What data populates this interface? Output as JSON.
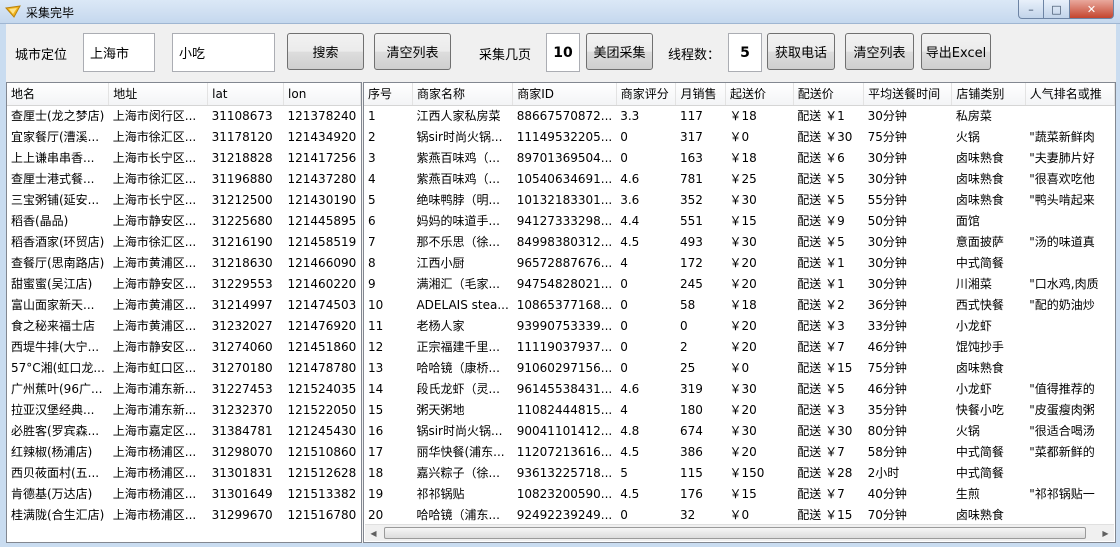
{
  "window": {
    "title": "采集完毕",
    "min": "–",
    "max": "□",
    "close": "✕"
  },
  "toolbar": {
    "city_label": "城市定位",
    "city_value": "上海市",
    "keyword_value": "小吃",
    "search_btn": "搜索",
    "clear_btn1": "清空列表",
    "pages_label": "采集几页",
    "pages_value": "10",
    "meituan_btn": "美团采集",
    "threads_label": "线程数：",
    "threads_value": "5",
    "phone_btn": "获取电话",
    "clear_btn2": "清空列表",
    "export_btn": "导出Excel"
  },
  "left_grid": {
    "columns": [
      "地名",
      "地址",
      "lat",
      "lon"
    ],
    "rows": [
      [
        "查厘士(龙之梦店)",
        "上海市闵行区...",
        "31108673",
        "121378240"
      ],
      [
        "宜家餐厅(漕溪...",
        "上海市徐汇区...",
        "31178120",
        "121434920"
      ],
      [
        "上上谦串串香...",
        "上海市长宁区...",
        "31218828",
        "121417256"
      ],
      [
        "查厘士港式餐...",
        "上海市徐汇区...",
        "31196880",
        "121437280"
      ],
      [
        "三宝粥铺(延安...",
        "上海市长宁区...",
        "31212500",
        "121430190"
      ],
      [
        "稻香(晶品)",
        "上海市静安区...",
        "31225680",
        "121445895"
      ],
      [
        "稻香酒家(环贸店)",
        "上海市徐汇区...",
        "31216190",
        "121458519"
      ],
      [
        "查餐厅(思南路店)",
        "上海市黄浦区...",
        "31218630",
        "121466090"
      ],
      [
        "甜蜜蜜(吴江店)",
        "上海市静安区...",
        "31229553",
        "121460220"
      ],
      [
        "富山面家新天...",
        "上海市黄浦区...",
        "31214997",
        "121474503"
      ],
      [
        "食之秘来福士店",
        "上海市黄浦区...",
        "31232027",
        "121476920"
      ],
      [
        "西堤牛排(大宁...",
        "上海市静安区...",
        "31274060",
        "121451860"
      ],
      [
        "57°C湘(虹口龙...",
        "上海市虹口区...",
        "31270180",
        "121478780"
      ],
      [
        "广州蕉叶(96广...",
        "上海市浦东新...",
        "31227453",
        "121524035"
      ],
      [
        "拉亚汉堡经典...",
        "上海市浦东新...",
        "31232370",
        "121522050"
      ],
      [
        "必胜客(罗宾森...",
        "上海市嘉定区...",
        "31384781",
        "121245430"
      ],
      [
        "红辣椒(杨浦店)",
        "上海市杨浦区...",
        "31298070",
        "121510860"
      ],
      [
        "西贝莜面村(五...",
        "上海市杨浦区...",
        "31301831",
        "121512628"
      ],
      [
        "肯德基(万达店)",
        "上海市杨浦区...",
        "31301649",
        "121513382"
      ],
      [
        "桂满陇(合生汇店)",
        "上海市杨浦区...",
        "31299670",
        "121516780"
      ]
    ]
  },
  "right_grid": {
    "columns": [
      "序号",
      "商家名称",
      "商家ID",
      "商家评分",
      "月销售",
      "起送价",
      "配送价",
      "平均送餐时间",
      "店铺类别",
      "人气排名或推"
    ],
    "rows": [
      [
        "1",
        "江西人家私房菜",
        "88667570872...",
        "3.3",
        "117",
        "￥18",
        "配送 ￥1",
        "30分钟",
        "私房菜",
        ""
      ],
      [
        "2",
        "锅sir时尚火锅...",
        "11149532205...",
        "0",
        "317",
        "￥0",
        "配送 ￥30",
        "75分钟",
        "火锅",
        "\"蔬菜新鲜肉"
      ],
      [
        "3",
        "紫燕百味鸡（...",
        "89701369504...",
        "0",
        "163",
        "￥18",
        "配送 ￥6",
        "30分钟",
        "卤味熟食",
        "\"夫妻肺片好"
      ],
      [
        "4",
        "紫燕百味鸡（...",
        "10540634691...",
        "4.6",
        "781",
        "￥25",
        "配送 ￥5",
        "30分钟",
        "卤味熟食",
        "\"很喜欢吃他"
      ],
      [
        "5",
        "绝味鸭脖（明...",
        "10132183301...",
        "3.6",
        "352",
        "￥30",
        "配送 ￥5",
        "55分钟",
        "卤味熟食",
        "\"鸭头啃起来"
      ],
      [
        "6",
        "妈妈的味道手...",
        "94127333298...",
        "4.4",
        "551",
        "￥15",
        "配送 ￥9",
        "50分钟",
        "面馆",
        ""
      ],
      [
        "7",
        "那不乐思（徐...",
        "84998380312...",
        "4.5",
        "493",
        "￥30",
        "配送 ￥5",
        "30分钟",
        "意面披萨",
        "\"汤的味道真"
      ],
      [
        "8",
        "江西小厨",
        "96572887676...",
        "4",
        "172",
        "￥20",
        "配送 ￥1",
        "30分钟",
        "中式简餐",
        ""
      ],
      [
        "9",
        "满湘汇（毛家...",
        "94754828021...",
        "0",
        "245",
        "￥20",
        "配送 ￥1",
        "30分钟",
        "川湘菜",
        "\"口水鸡,肉质"
      ],
      [
        "10",
        "ADELAIS stea...",
        "10865377168...",
        "0",
        "58",
        "￥18",
        "配送 ￥2",
        "36分钟",
        "西式快餐",
        "\"配的奶油炒"
      ],
      [
        "11",
        "老杨人家",
        "93990753339...",
        "0",
        "0",
        "￥20",
        "配送 ￥3",
        "33分钟",
        "小龙虾",
        ""
      ],
      [
        "12",
        "正宗福建千里...",
        "11119037937...",
        "0",
        "2",
        "￥20",
        "配送 ￥7",
        "46分钟",
        "馄饨抄手",
        ""
      ],
      [
        "13",
        "哈哈镜（康桥...",
        "91060297156...",
        "0",
        "25",
        "￥0",
        "配送 ￥15",
        "75分钟",
        "卤味熟食",
        ""
      ],
      [
        "14",
        "段氏龙虾（灵...",
        "96145538431...",
        "4.6",
        "319",
        "￥30",
        "配送 ￥5",
        "46分钟",
        "小龙虾",
        "\"值得推荐的"
      ],
      [
        "15",
        "粥天粥地",
        "11082444815...",
        "4",
        "180",
        "￥20",
        "配送 ￥3",
        "35分钟",
        "快餐小吃",
        "\"皮蛋瘦肉粥"
      ],
      [
        "16",
        "锅sir时尚火锅...",
        "90041101412...",
        "4.8",
        "674",
        "￥30",
        "配送 ￥30",
        "80分钟",
        "火锅",
        "\"很适合喝汤"
      ],
      [
        "17",
        "丽华快餐(浦东...",
        "11207213616...",
        "4.5",
        "386",
        "￥20",
        "配送 ￥7",
        "58分钟",
        "中式简餐",
        "\"菜都新鲜的"
      ],
      [
        "18",
        "嘉兴粽子（徐...",
        "93613225718...",
        "5",
        "115",
        "￥150",
        "配送 ￥28",
        "2小时",
        "中式简餐",
        ""
      ],
      [
        "19",
        "祁祁锅贴",
        "10823200590...",
        "4.5",
        "176",
        "￥15",
        "配送 ￥7",
        "40分钟",
        "生煎",
        "\"祁祁锅贴一"
      ],
      [
        "20",
        "哈哈镜（浦东...",
        "92492239249...",
        "0",
        "32",
        "￥0",
        "配送 ￥15",
        "70分钟",
        "卤味熟食",
        ""
      ]
    ]
  },
  "icons": {
    "app": "app-icon",
    "scroll_left": "◀",
    "scroll_right": "▶"
  }
}
